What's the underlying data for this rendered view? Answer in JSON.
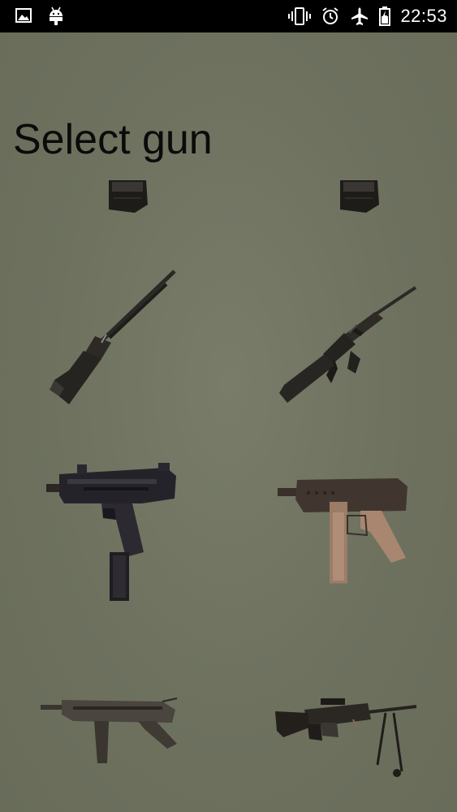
{
  "status_bar": {
    "time": "22:53",
    "left_icons": [
      "image-notification-icon",
      "android-debug-icon"
    ],
    "right_icons": [
      "vibrate-icon",
      "alarm-icon",
      "airplane-mode-icon",
      "battery-icon"
    ]
  },
  "page": {
    "title": "Select gun"
  },
  "guns": [
    {
      "name": "magazine-left",
      "icon": "magazine-icon"
    },
    {
      "name": "magazine-right",
      "icon": "magazine-icon"
    },
    {
      "name": "shotgun",
      "icon": "shotgun-icon"
    },
    {
      "name": "assault-rifle",
      "icon": "assault-rifle-icon"
    },
    {
      "name": "uzi",
      "icon": "uzi-icon"
    },
    {
      "name": "tec9",
      "icon": "machine-pistol-icon"
    },
    {
      "name": "mp40",
      "icon": "submachine-gun-icon"
    },
    {
      "name": "machine-gun",
      "icon": "machine-gun-icon"
    }
  ],
  "colors": {
    "background": "#6e725f",
    "status_bar": "#000000",
    "title_text": "#0b0b0b"
  }
}
